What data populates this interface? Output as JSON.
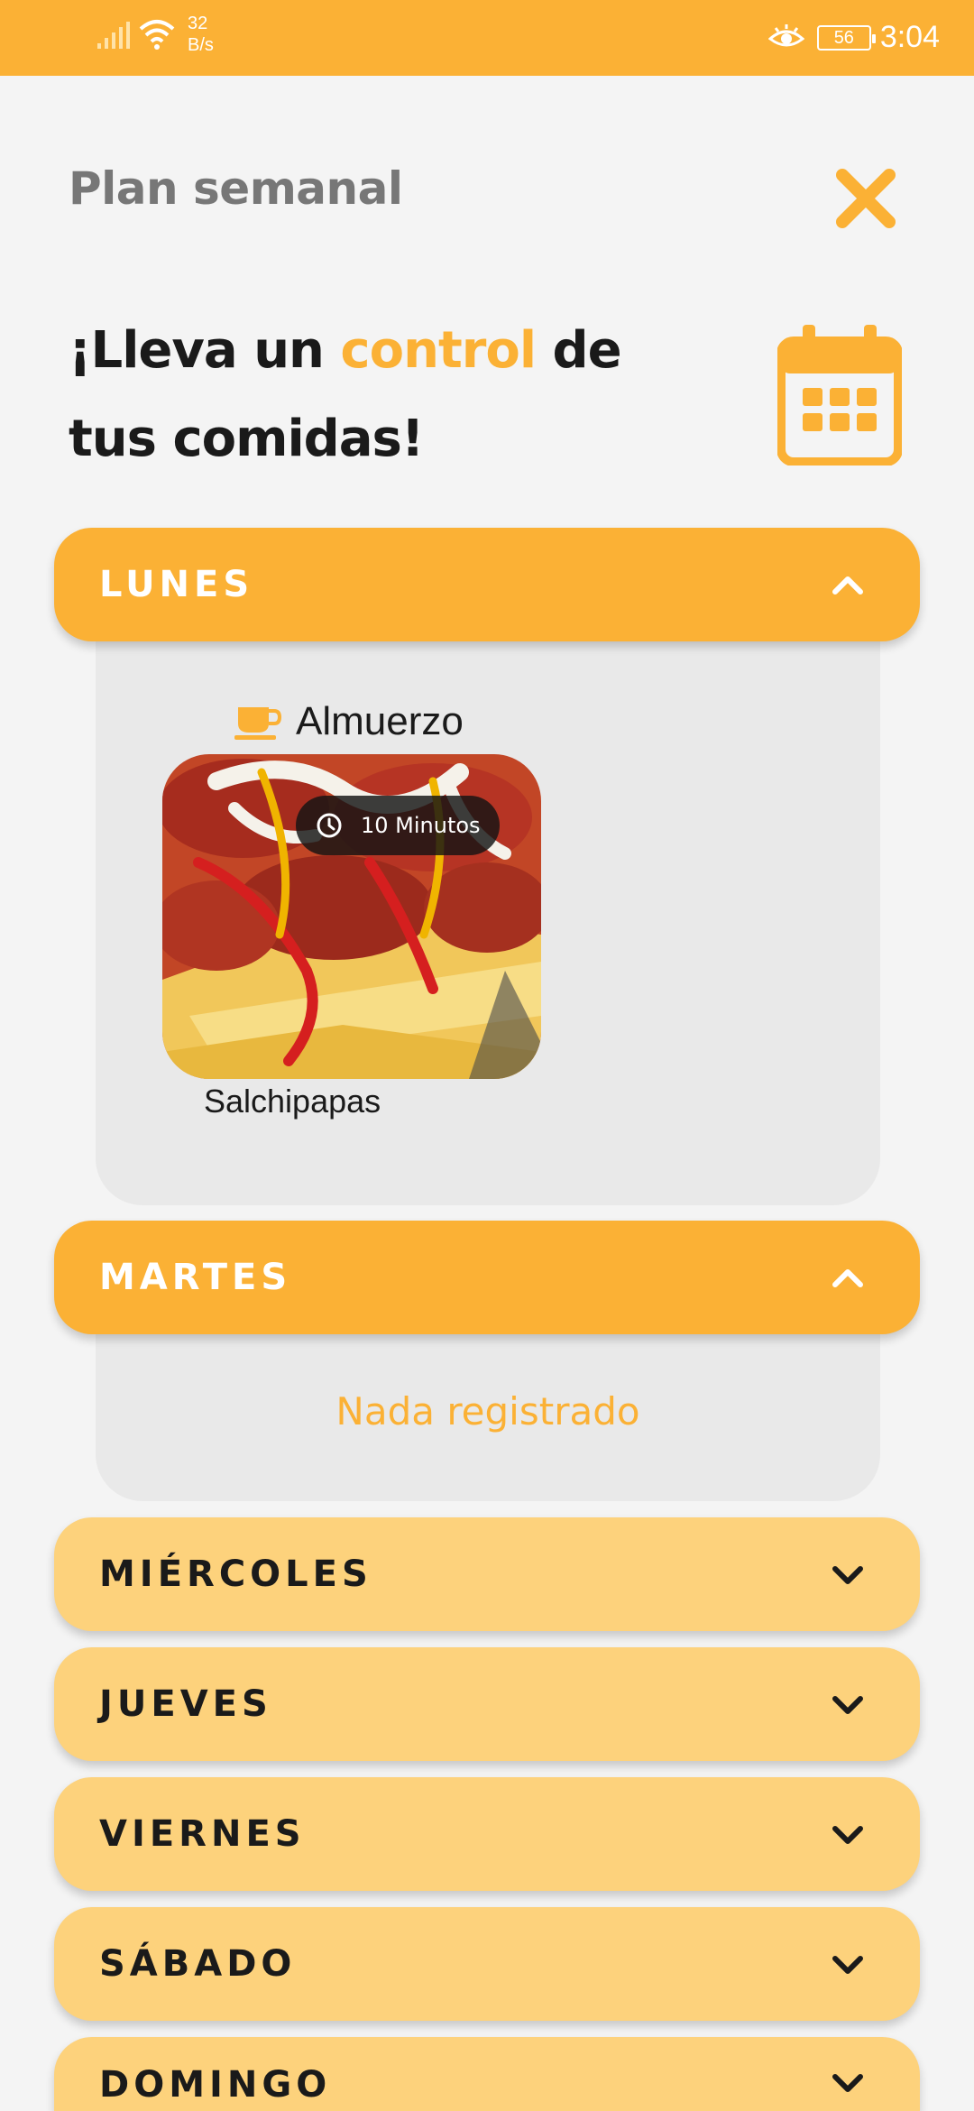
{
  "status_bar": {
    "network_speed_value": "32",
    "network_speed_unit": "B/s",
    "battery": "56",
    "time": "3:04",
    "icons": [
      "signal-icon",
      "wifi-icon",
      "eye-icon",
      "battery-icon"
    ]
  },
  "header": {
    "title": "Plan semanal",
    "close_icon": "close-icon"
  },
  "headline": {
    "part1": "¡Lleva un ",
    "accent": "control",
    "part2": " de tus comidas!",
    "icon": "calendar-icon"
  },
  "colors": {
    "accent": "#fbb135",
    "accent_light": "#fdd27c",
    "panel": "#e9e9e9",
    "background": "#f4f4f4"
  },
  "days": [
    {
      "label": "LUNES",
      "expanded": true,
      "meals": [
        {
          "type": "Almuerzo",
          "type_icon": "coffee-cup-icon",
          "time": "10 Minutos",
          "time_icon": "clock-icon",
          "name": "Salchipapas"
        }
      ]
    },
    {
      "label": "MARTES",
      "expanded": true,
      "empty_text": "Nada registrado"
    },
    {
      "label": "MIÉRCOLES",
      "expanded": false
    },
    {
      "label": "JUEVES",
      "expanded": false
    },
    {
      "label": "VIERNES",
      "expanded": false
    },
    {
      "label": "SÁBADO",
      "expanded": false
    },
    {
      "label": "DOMINGO",
      "expanded": false
    }
  ]
}
